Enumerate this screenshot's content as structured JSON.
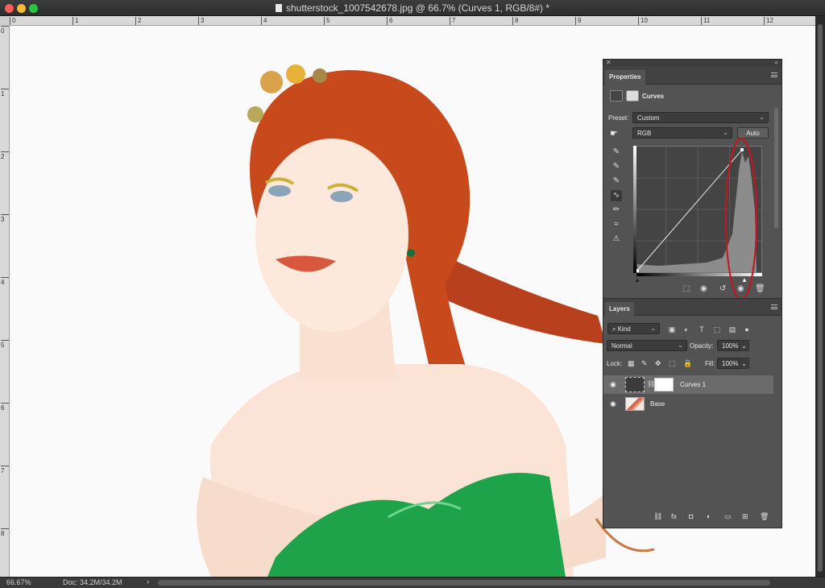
{
  "window": {
    "title": "shutterstock_1007542678.jpg @ 66.7% (Curves 1, RGB/8#) *"
  },
  "rulers": {
    "top_ticks": [
      "0",
      "1",
      "2",
      "3",
      "4",
      "5",
      "6",
      "7",
      "8",
      "9",
      "10",
      "11",
      "12"
    ],
    "left_ticks": [
      "0",
      "1",
      "2",
      "3",
      "4",
      "5",
      "6",
      "7",
      "8"
    ]
  },
  "status": {
    "zoom": "66.67%",
    "doc": "Doc: 34.2M/34.2M",
    "arrow": "›"
  },
  "properties": {
    "tab": "Properties",
    "title": "Curves",
    "preset_label": "Preset:",
    "preset_value": "Custom",
    "channel_value": "RGB",
    "auto_button": "Auto",
    "histogram_highlight_color": "#c8141e"
  },
  "layers": {
    "tab": "Layers",
    "kind_value": "Kind",
    "blend_mode": "Normal",
    "opacity_label": "Opacity:",
    "opacity_value": "100%",
    "lock_label": "Lock:",
    "fill_label": "Fill:",
    "fill_value": "100%",
    "items": [
      {
        "name": "Curves 1",
        "selected": true
      },
      {
        "name": "Base",
        "selected": false
      }
    ]
  },
  "colors": {
    "panel_bg": "#535353",
    "hair": "#c84a1c",
    "dress": "#1fa34a",
    "skin": "#fbe4d6"
  }
}
